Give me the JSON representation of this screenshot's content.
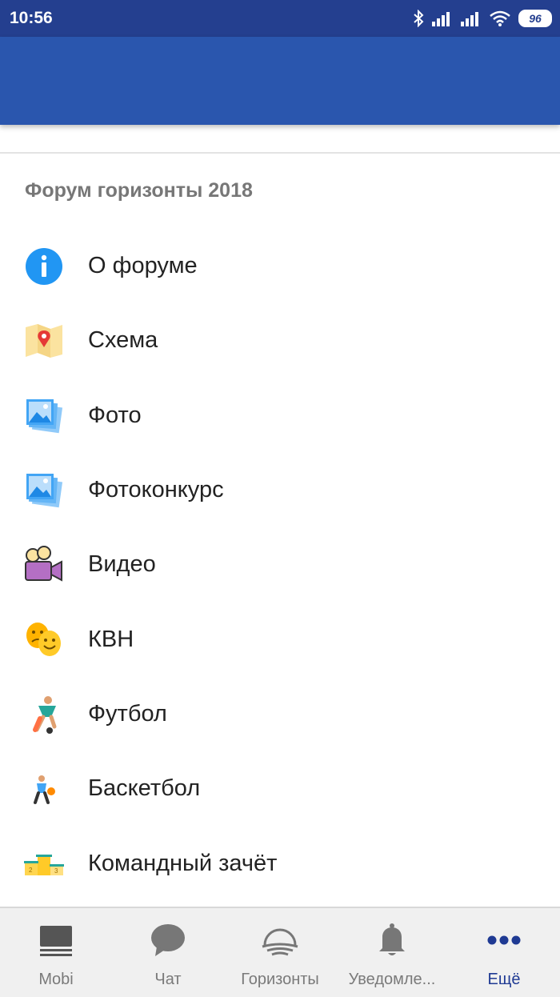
{
  "status_bar": {
    "time": "10:56",
    "battery": "96"
  },
  "section": {
    "title": "Форум горизонты 2018"
  },
  "menu": {
    "items": [
      {
        "label": "О форуме",
        "icon": "info-icon"
      },
      {
        "label": "Схема",
        "icon": "map-icon"
      },
      {
        "label": "Фото",
        "icon": "photos-icon"
      },
      {
        "label": "Фотоконкурс",
        "icon": "photos-icon"
      },
      {
        "label": "Видео",
        "icon": "video-camera-icon"
      },
      {
        "label": "КВН",
        "icon": "theater-masks-icon"
      },
      {
        "label": "Футбол",
        "icon": "football-player-icon"
      },
      {
        "label": "Баскетбол",
        "icon": "basketball-player-icon"
      },
      {
        "label": "Командный зачёт",
        "icon": "podium-icon"
      }
    ]
  },
  "bottom_nav": {
    "tabs": [
      {
        "label": "Mobi",
        "icon": "monitor-icon"
      },
      {
        "label": "Чат",
        "icon": "chat-bubble-icon"
      },
      {
        "label": "Горизонты",
        "icon": "horizon-logo-icon"
      },
      {
        "label": "Уведомле...",
        "icon": "bell-icon"
      },
      {
        "label": "Ещё",
        "icon": "more-dots-icon",
        "active": true
      }
    ]
  },
  "colors": {
    "status_bar": "#243f8f",
    "app_bar": "#2a56ae",
    "active_tab": "#1f3a93",
    "inactive_tab": "#7a7a7a"
  }
}
